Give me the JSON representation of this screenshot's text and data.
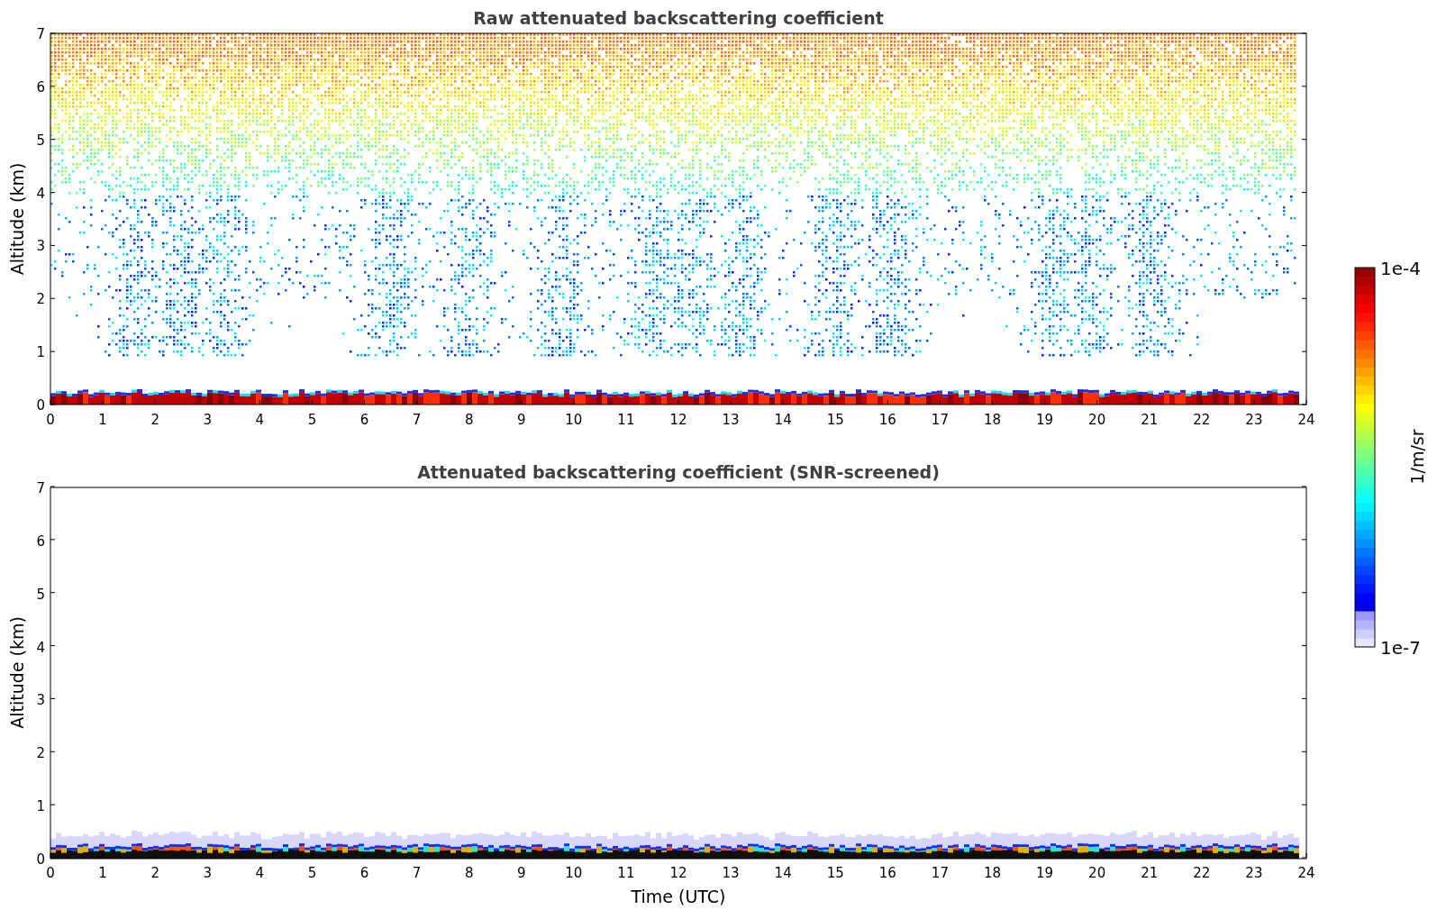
{
  "panels": [
    {
      "kind": "raw",
      "title": "Raw attenuated backscattering coefficient",
      "ylabel": "Altitude (km)",
      "yticks": [
        "7",
        "6",
        "5",
        "4",
        "3",
        "2",
        "1",
        "0"
      ],
      "xticks": [
        "0",
        "1",
        "2",
        "3",
        "4",
        "5",
        "6",
        "7",
        "8",
        "9",
        "10",
        "11",
        "12",
        "13",
        "14",
        "15",
        "16",
        "17",
        "18",
        "19",
        "20",
        "21",
        "22",
        "23",
        "24"
      ]
    },
    {
      "kind": "screened",
      "title": "Attenuated backscattering coefficient (SNR-screened)",
      "ylabel": "Altitude (km)",
      "yticks": [
        "7",
        "6",
        "5",
        "4",
        "3",
        "2",
        "1",
        "0"
      ],
      "xticks": [
        "0",
        "1",
        "2",
        "3",
        "4",
        "5",
        "6",
        "7",
        "8",
        "9",
        "10",
        "11",
        "12",
        "13",
        "14",
        "15",
        "16",
        "17",
        "18",
        "19",
        "20",
        "21",
        "22",
        "23",
        "24"
      ],
      "xlabel": "Time (UTC)"
    }
  ],
  "colorbar": {
    "max_label": "1e-4",
    "min_label": "1e-7",
    "unit_label": "1/m/sr"
  }
}
